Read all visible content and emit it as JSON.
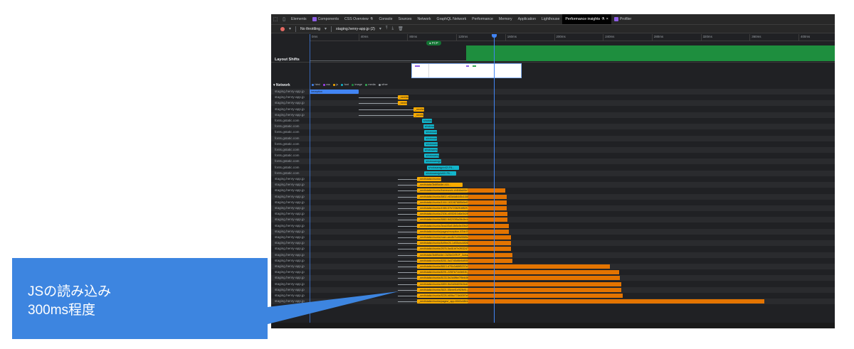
{
  "devtools": {
    "tabs": [
      "Elements",
      "Components",
      "CSS Overview",
      "Console",
      "Sources",
      "Network",
      "GraphQL Network",
      "Performance",
      "Memory",
      "Application",
      "Lighthouse",
      "Performance insights",
      "Profiler"
    ],
    "active_tab_index": 11,
    "toolbar": {
      "throttling": "No throttling",
      "recording": "staging.henry-app.jp (2)"
    },
    "ruler_ticks": [
      "0ms",
      "40ms",
      "80ms",
      "120ms",
      "160ms",
      "200ms",
      "240ms",
      "280ms",
      "320ms",
      "360ms",
      "400ms"
    ],
    "fcp_label": "FCP",
    "layout_shifts_label": "Layout Shifts",
    "network": {
      "label": "Network",
      "legend": [
        {
          "name": "html",
          "color": "#4285f4"
        },
        {
          "name": "css",
          "color": "#a142f4"
        },
        {
          "name": "js",
          "color": "#f9ab00"
        },
        {
          "name": "font",
          "color": "#12b5cb"
        },
        {
          "name": "image",
          "color": "#1e8e3e"
        },
        {
          "name": "media",
          "color": "#34a853"
        },
        {
          "name": "other",
          "color": "#9aa0a6"
        }
      ],
      "rows": [
        {
          "host": "staging.henry-app.jp",
          "type": "html",
          "start": 0,
          "end": 40,
          "wait_start": 0,
          "ext_end": null,
          "text": "/reception"
        },
        {
          "host": "staging.henry-app.jp",
          "type": "js",
          "start": 72,
          "end": 81,
          "wait_start": 40,
          "ext_end": null,
          "text": "_next/static/..."
        },
        {
          "host": "staging.henry-app.jp",
          "type": "js",
          "start": 72,
          "end": 80,
          "wait_start": 40,
          "ext_end": null,
          "text": "_next/static/ch..."
        },
        {
          "host": "staging.henry-app.jp",
          "type": "js",
          "start": 85,
          "end": 94,
          "wait_start": 40,
          "ext_end": null,
          "text": "_next/static/..."
        },
        {
          "host": "staging.henry-app.jp",
          "type": "js",
          "start": 85,
          "end": 93,
          "wait_start": 40,
          "ext_end": null,
          "text": "_next/static/c..."
        },
        {
          "host": "fonts.gstatic.com",
          "type": "font",
          "start": 92,
          "end": 100,
          "wait_start": null,
          "ext_end": null,
          "text": "s/notosa..."
        },
        {
          "host": "fonts.gstatic.com",
          "type": "font",
          "start": 93,
          "end": 102,
          "wait_start": null,
          "ext_end": null,
          "text": "s/notosa..."
        },
        {
          "host": "fonts.gstatic.com",
          "type": "font",
          "start": 94,
          "end": 104,
          "wait_start": null,
          "ext_end": null,
          "text": "s/notosans..."
        },
        {
          "host": "fonts.gstatic.com",
          "type": "font",
          "start": 94,
          "end": 104,
          "wait_start": null,
          "ext_end": null,
          "text": "s/notosansj..."
        },
        {
          "host": "fonts.gstatic.com",
          "type": "font",
          "start": 94,
          "end": 105,
          "wait_start": null,
          "ext_end": null,
          "text": "s/notosansj..."
        },
        {
          "host": "fonts.gstatic.com",
          "type": "font",
          "start": 93,
          "end": 105,
          "wait_start": null,
          "ext_end": null,
          "text": "s/notosansjp/..."
        },
        {
          "host": "fonts.gstatic.com",
          "type": "font",
          "start": 94,
          "end": 106,
          "wait_start": null,
          "ext_end": null,
          "text": "s/notosansjp..."
        },
        {
          "host": "fonts.gstatic.com",
          "type": "font",
          "start": 94,
          "end": 108,
          "wait_start": null,
          "ext_end": null,
          "text": "s/notosansjp/..."
        },
        {
          "host": "fonts.gstatic.com",
          "type": "font",
          "start": 96,
          "end": 122,
          "wait_start": null,
          "ext_end": null,
          "text": "s/notosansjp/v42/-F6..."
        },
        {
          "host": "fonts.gstatic.com",
          "type": "font",
          "start": 94,
          "end": 120,
          "wait_start": null,
          "ext_end": null,
          "text": "s/notosansjp/v42/-F6..."
        },
        {
          "host": "staging.henry-app.jp",
          "type": "js",
          "start": 88,
          "end": 108,
          "wait_start": 72,
          "ext_end": null,
          "text": "_next/static/chunks/webpack..."
        },
        {
          "host": "staging.henry-app.jp",
          "type": "js",
          "start": 88,
          "end": 125,
          "wait_start": 72,
          "ext_end": null,
          "text": "_next/static/3b8f5d4bf-415..."
        },
        {
          "host": "staging.henry-app.jp",
          "type": "js",
          "start": 88,
          "end": 130,
          "wait_start": 72,
          "ext_end": 160,
          "text": "_next/static/chunks/framework-cb4b8a4f4e755a.js"
        },
        {
          "host": "staging.henry-app.jp",
          "type": "js",
          "start": 88,
          "end": 130,
          "wait_start": 72,
          "ext_end": 161,
          "text": "_next/static/chunks/5802-e83d4d6445c1158c.js"
        },
        {
          "host": "staging.henry-app.jp",
          "type": "js",
          "start": 88,
          "end": 130,
          "wait_start": 72,
          "ext_end": 161,
          "text": "_next/static/chunks/1444-1631f8788f5b5ef2.js"
        },
        {
          "host": "staging.henry-app.jp",
          "type": "js",
          "start": 88,
          "end": 130,
          "wait_start": 72,
          "ext_end": 161,
          "text": "_next/static/chunks/1065-57b72362f16f529.js"
        },
        {
          "host": "staging.henry-app.jp",
          "type": "js",
          "start": 88,
          "end": 130,
          "wait_start": 72,
          "ext_end": 162,
          "text": "_next/static/chunks/2306-c6930f10d6e0b2f8.js"
        },
        {
          "host": "staging.henry-app.jp",
          "type": "js",
          "start": 88,
          "end": 130,
          "wait_start": 72,
          "ext_end": 162,
          "text": "_next/static/chunks/5860-fb5203f5a3fb4fe4c.js"
        },
        {
          "host": "staging.henry-app.jp",
          "type": "js",
          "start": 88,
          "end": 130,
          "wait_start": 72,
          "ext_end": 163,
          "text": "_next/static/chunks/3ea445a9-8b5c5e20b2f8565.js"
        },
        {
          "host": "staging.henry-app.jp",
          "type": "js",
          "start": 88,
          "end": 130,
          "wait_start": 72,
          "ext_end": 163,
          "text": "_next/static/chunks/pages/reception-87bb76e485a4a...js"
        },
        {
          "host": "staging.henry-app.jp",
          "type": "js",
          "start": 88,
          "end": 130,
          "wait_start": 72,
          "ext_end": 165,
          "text": "_next/static/chunks/main-aec8b7c49d5585ed1.js"
        },
        {
          "host": "staging.henry-app.jp",
          "type": "js",
          "start": 88,
          "end": 130,
          "wait_start": 72,
          "ext_end": 165,
          "text": "_next/static/chunks/6d9be26-1df35cbc4826b90.js"
        },
        {
          "host": "staging.henry-app.jp",
          "type": "js",
          "start": 88,
          "end": 130,
          "wait_start": 72,
          "ext_end": 165,
          "text": "_next/static/chunks/2676-5a48-bf7e2f032478d0d9.js"
        },
        {
          "host": "staging.henry-app.jp",
          "type": "js",
          "start": 88,
          "end": 130,
          "wait_start": 72,
          "ext_end": 166,
          "text": "_next/static/3b8f5d4bf-C5Z5e3XRVF_3u/ssgManifest.js"
        },
        {
          "host": "staging.henry-app.jp",
          "type": "js",
          "start": 88,
          "end": 130,
          "wait_start": 72,
          "ext_end": 166,
          "text": "_next/static/chunks/6261-5a37d5df8e6df0557.js"
        },
        {
          "host": "staging.henry-app.jp",
          "type": "js",
          "start": 88,
          "end": 130,
          "wait_start": 72,
          "ext_end": 246,
          "text": "_next/static/chunks/5813-d7f0c3d68f0237a7.js"
        },
        {
          "host": "staging.henry-app.jp",
          "type": "js",
          "start": 88,
          "end": 130,
          "wait_start": 72,
          "ext_end": 253,
          "text": "_next/static/chunks/6291-225f7b71b3bf1f0.js"
        },
        {
          "host": "staging.henry-app.jp",
          "type": "js",
          "start": 88,
          "end": 130,
          "wait_start": 72,
          "ext_end": 254,
          "text": "_next/static/chunks/5133-5e2d4ffbe7f9eb4fe.js"
        },
        {
          "host": "staging.henry-app.jp",
          "type": "js",
          "start": 88,
          "end": 130,
          "wait_start": 72,
          "ext_end": 255,
          "text": "_next/static/chunks/4859-f6e0d0b809b3bd20.js"
        },
        {
          "host": "staging.henry-app.jp",
          "type": "js",
          "start": 88,
          "end": 130,
          "wait_start": 72,
          "ext_end": 255,
          "text": "_next/static/chunks/3621-55eeef1e9f2fb91.js"
        },
        {
          "host": "staging.henry-app.jp",
          "type": "js",
          "start": 88,
          "end": 130,
          "wait_start": 72,
          "ext_end": 256,
          "text": "_next/static/chunks/9226-b69bc774b0097e6.js"
        },
        {
          "host": "staging.henry-app.jp",
          "type": "js",
          "start": 88,
          "end": 130,
          "wait_start": 72,
          "ext_end": 372,
          "text": "_next/static/chunks/pages/_app-6540c48b1e5b6f6b.js"
        }
      ]
    }
  },
  "callout": {
    "line1": "JSの読み込み",
    "line2": "300ms程度",
    "color": "#3d85e0"
  }
}
